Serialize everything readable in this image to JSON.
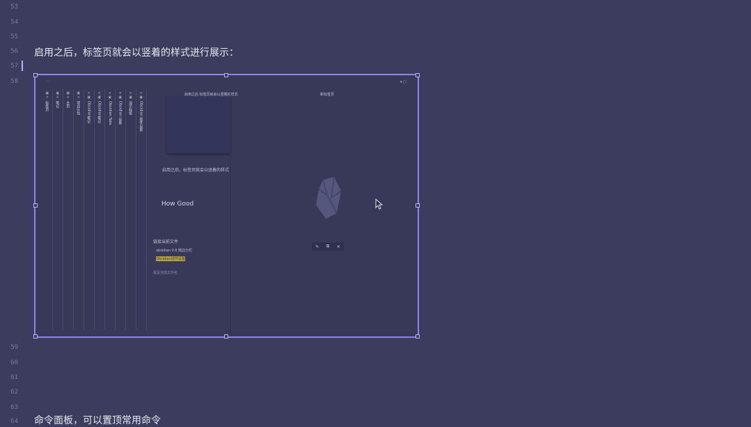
{
  "line_numbers": [
    "53",
    "54",
    "55",
    "56",
    "57",
    "58",
    "59",
    "60",
    "61",
    "62",
    "63",
    "64"
  ],
  "line56_text": "启用之后，标签页就会以竖着的样式进行展示：",
  "line64_text": "命令面板，可以置顶常用命令",
  "embed": {
    "vertical_tabs": [
      "标签页",
      "笔记",
      "主页",
      "项目计划",
      "Obsidian笔记",
      "Obsidian笔记",
      "Obsidian Tabs",
      "Obsidian 设置",
      "显示标签",
      "Obsidian 插件设置"
    ],
    "inner_title": "启用之后 标签页就会以竖着的样式",
    "inner_text": "启用之后，标签页就会以竖着的样式",
    "how_good": "How Good",
    "backlinks_title": "链接当前文件",
    "backlinks_item": "obsidian 0.6 侧边分栏",
    "highlight": "Obsidian插件设置",
    "unlinked": "提及当前文件名",
    "right_title": "新标签页",
    "toolbar_icons": [
      "edit-icon",
      "copy-icon",
      "close-icon"
    ]
  },
  "colors": {
    "background": "#3b3c5e",
    "accent": "#8c86e6"
  }
}
